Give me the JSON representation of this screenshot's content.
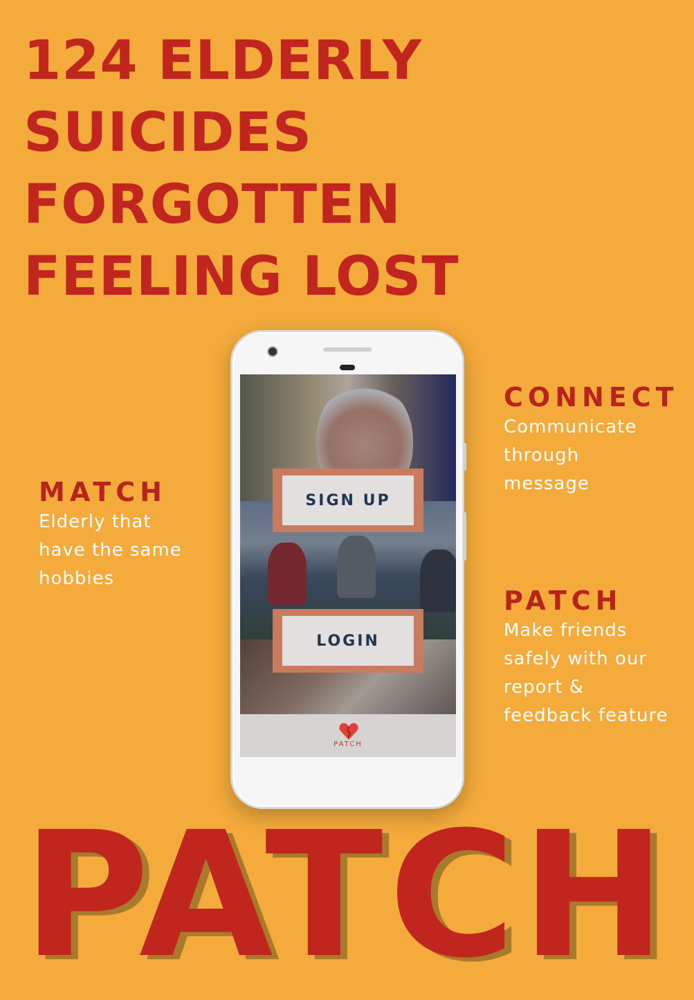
{
  "headline": {
    "lines": [
      "124 ELDERLY",
      "SUICIDES",
      "FORGOTTEN",
      "FEELING LOST"
    ]
  },
  "features": {
    "match": {
      "title": "MATCH",
      "desc": "Elderly that\nhave the same\nhobbies"
    },
    "connect": {
      "title": "CONNECT",
      "desc": "Communicate\nthrough\nmessage"
    },
    "patch": {
      "title": "PATCH",
      "desc": "Make friends\nsafely with our\nreport &\nfeedback feature"
    }
  },
  "app": {
    "signup_label": "SIGN UP",
    "login_label": "LOGIN",
    "logo_text": "PATCH"
  },
  "brand": {
    "name": "PATCH"
  },
  "colors": {
    "background": "#f4ab3b",
    "headline": "#c0261e",
    "button_border": "#c77b5f",
    "button_text": "#1f3550"
  },
  "icons": [
    "heart-logo-icon",
    "camera-icon",
    "speaker-icon"
  ]
}
